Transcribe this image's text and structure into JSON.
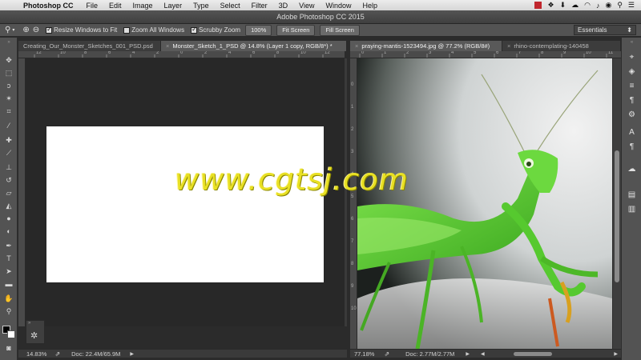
{
  "menubar": {
    "app": "Photoshop CC",
    "items": [
      "File",
      "Edit",
      "Image",
      "Layer",
      "Type",
      "Select",
      "Filter",
      "3D",
      "View",
      "Window",
      "Help"
    ]
  },
  "window": {
    "title": "Adobe Photoshop CC 2015"
  },
  "options": {
    "resize_label": "Resize Windows to Fit",
    "zoom_all_label": "Zoom All Windows",
    "scrubby_label": "Scrubby Zoom",
    "btn_100": "100%",
    "btn_fit": "Fit Screen",
    "btn_fill": "Fill Screen",
    "workspace": "Essentials"
  },
  "left_doc": {
    "tabs": [
      "Creating_Our_Monster_Sketches_001_PSD.psd",
      "Monster_Sketch_1_PSD @ 14.8% (Layer 1 copy, RGB/8*) *"
    ],
    "zoom": "14.83%",
    "doc_size": "Doc: 22.4M/65.9M",
    "ruler_numbers": [
      "12",
      "10",
      "8",
      "6",
      "4",
      "2",
      "0",
      "2",
      "4",
      "6",
      "8",
      "10",
      "12"
    ]
  },
  "right_doc": {
    "tabs": [
      "praying-mantis-1523494.jpg @ 77.2% (RGB/8#)",
      "rhino-contemplating-140458"
    ],
    "zoom": "77.18%",
    "doc_size": "Doc: 2.77M/2.77M",
    "ruler_numbers": [
      "0",
      "1",
      "2",
      "3",
      "4",
      "5",
      "6",
      "7",
      "8",
      "9",
      "10",
      "11"
    ],
    "vruler_numbers": [
      "0",
      "1",
      "2",
      "3",
      "4",
      "5",
      "6",
      "7",
      "8",
      "9",
      "10"
    ]
  },
  "watermark": "www.cgtsj.com",
  "colors": {
    "ui_dark": "#2b2b2b",
    "panel": "#535353",
    "watermark": "#e8e024",
    "mantis": "#5fd43a"
  }
}
